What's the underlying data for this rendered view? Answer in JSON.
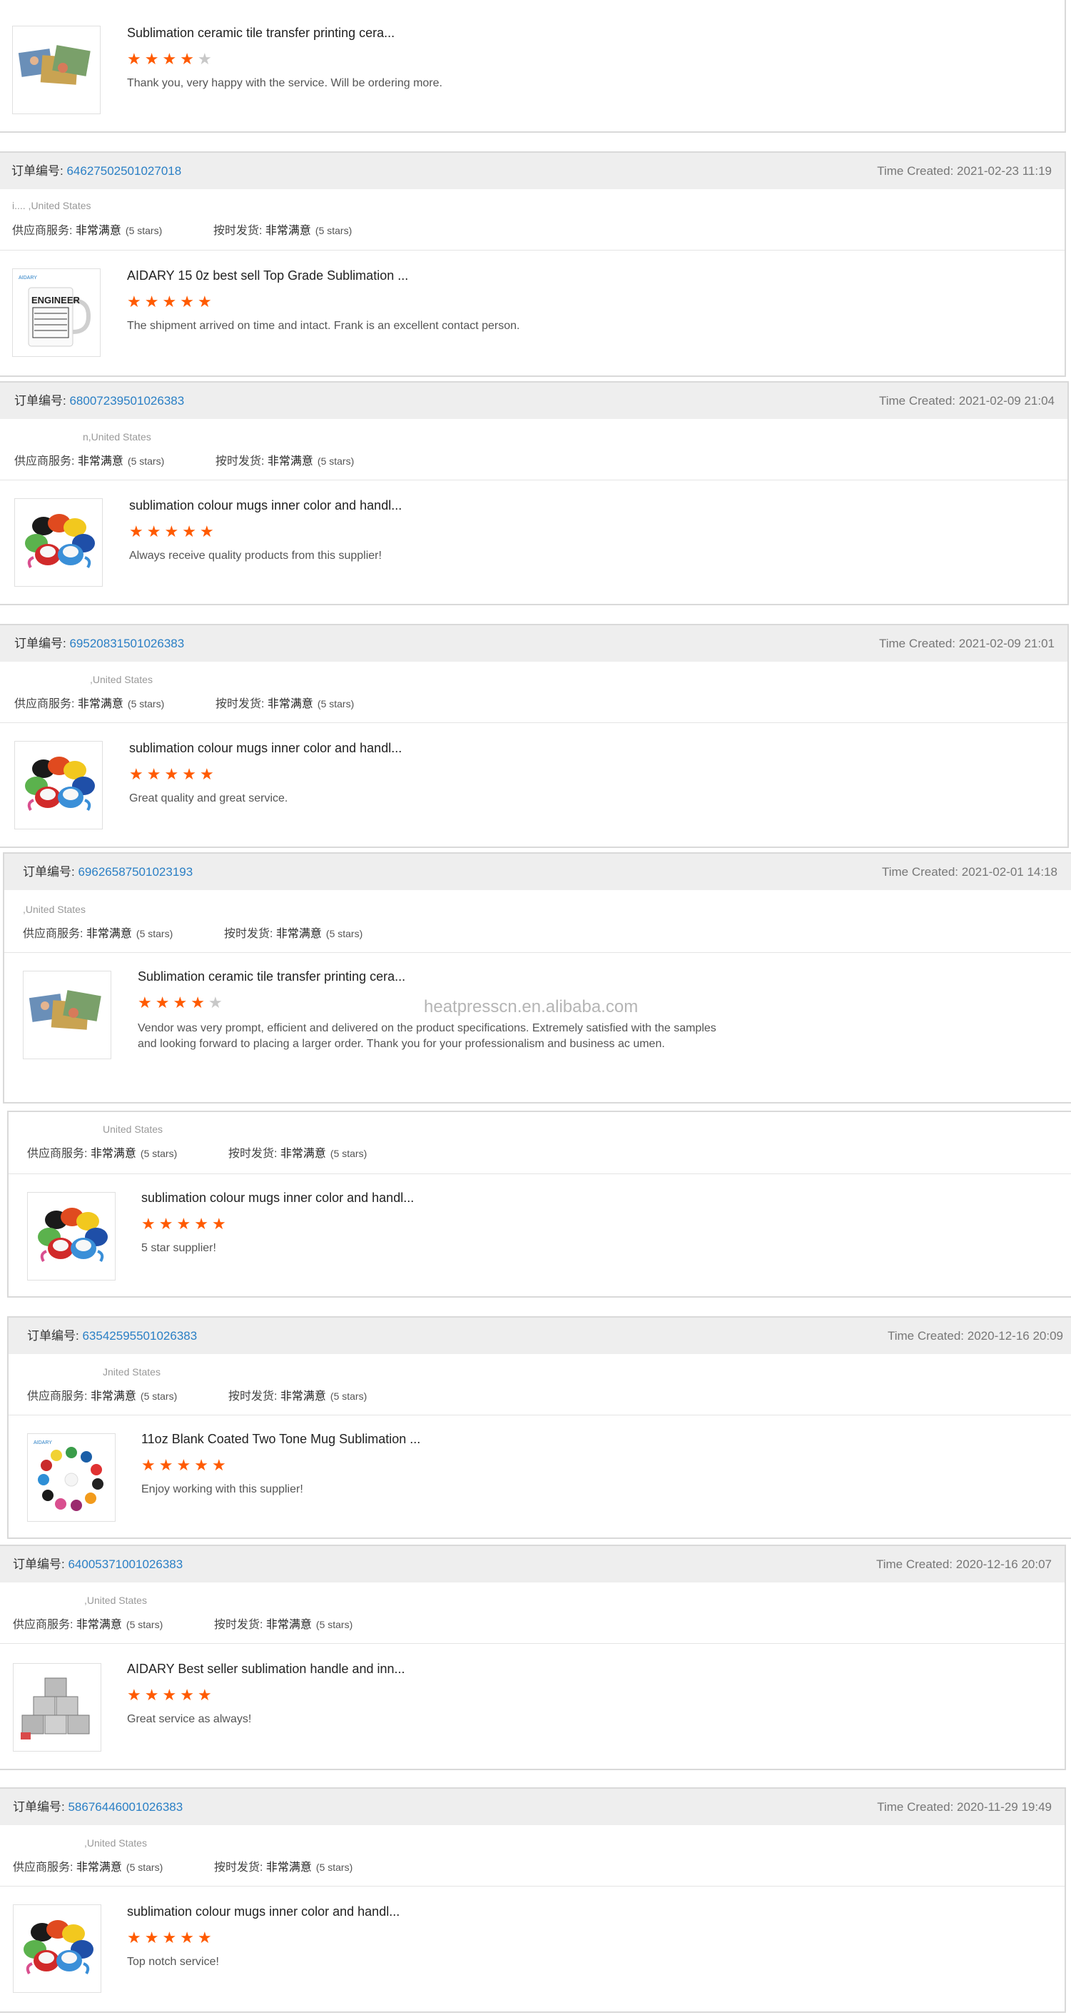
{
  "labels": {
    "order_no": "订单编号:",
    "time_created": "Time Created:",
    "supplier_service": "供应商服务:",
    "on_time": "按时发货:",
    "rating_text": "非常满意",
    "rating_count": "(5 stars)"
  },
  "watermark": "heatpresscn.en.alibaba.com",
  "colors": {
    "star_on": "#ff5a00",
    "star_off": "#c8c8c8",
    "order_link": "#2a7fc5"
  },
  "cards": [
    {
      "order": "",
      "time": "",
      "buyer": "",
      "product": "Sublimation ceramic tile transfer printing cera...",
      "stars": 4,
      "review": "Thank you, very happy with the service. Will be ordering more.",
      "thumb": "tile-photos-icon"
    },
    {
      "order": "64627502501027018",
      "time": "2021-02-23 11:19",
      "buyer": "i....             ,United States",
      "product": "AIDARY 15 0z best sell Top Grade Sublimation ...",
      "stars": 5,
      "review": "The shipment arrived on time and intact. Frank is an excellent contact person.",
      "thumb": "engineer-mug-icon"
    },
    {
      "order": "68007239501026383",
      "time": "2021-02-09 21:04",
      "buyer": "n,United States",
      "product": "sublimation colour mugs inner color and handl...",
      "stars": 5,
      "review": "Always receive quality products from this supplier!",
      "thumb": "color-mugs-icon"
    },
    {
      "order": "69520831501026383",
      "time": "2021-02-09 21:01",
      "buyer": ",United States",
      "product": "sublimation colour mugs inner color and handl...",
      "stars": 5,
      "review": "Great quality and great service.",
      "thumb": "color-mugs-icon"
    },
    {
      "order": "69626587501023193",
      "time": "2021-02-01 14:18",
      "buyer": ",United States",
      "product": "Sublimation ceramic tile transfer printing cera...",
      "stars": 4,
      "review": "Vendor was very prompt, efficient and delivered on the product specifications. Extremely satisfied with the samples and looking forward to placing a larger order. Thank you for your professionalism and business ac umen.",
      "thumb": "tile-photos-icon"
    },
    {
      "order": "",
      "time": "",
      "buyer": "United States",
      "product": "sublimation colour mugs inner color and handl...",
      "stars": 5,
      "review": "5 star supplier!",
      "thumb": "color-mugs-icon"
    },
    {
      "order": "63542595501026383",
      "time": "2020-12-16 20:09",
      "buyer": "Jnited States",
      "product": "11oz Blank Coated Two Tone Mug Sublimation ...",
      "stars": 5,
      "review": "Enjoy working with this supplier!",
      "thumb": "two-tone-mugs-icon"
    },
    {
      "order": "64005371001026383",
      "time": "2020-12-16 20:07",
      "buyer": ",United States",
      "product": "AIDARY Best seller sublimation handle and inn...",
      "stars": 5,
      "review": "Great service as always!",
      "thumb": "mug-pyramid-icon"
    },
    {
      "order": "58676446001026383",
      "time": "2020-11-29 19:49",
      "buyer": ",United States",
      "product": "sublimation colour mugs inner color and handl...",
      "stars": 5,
      "review": "Top notch service!",
      "thumb": "color-mugs-icon"
    }
  ]
}
